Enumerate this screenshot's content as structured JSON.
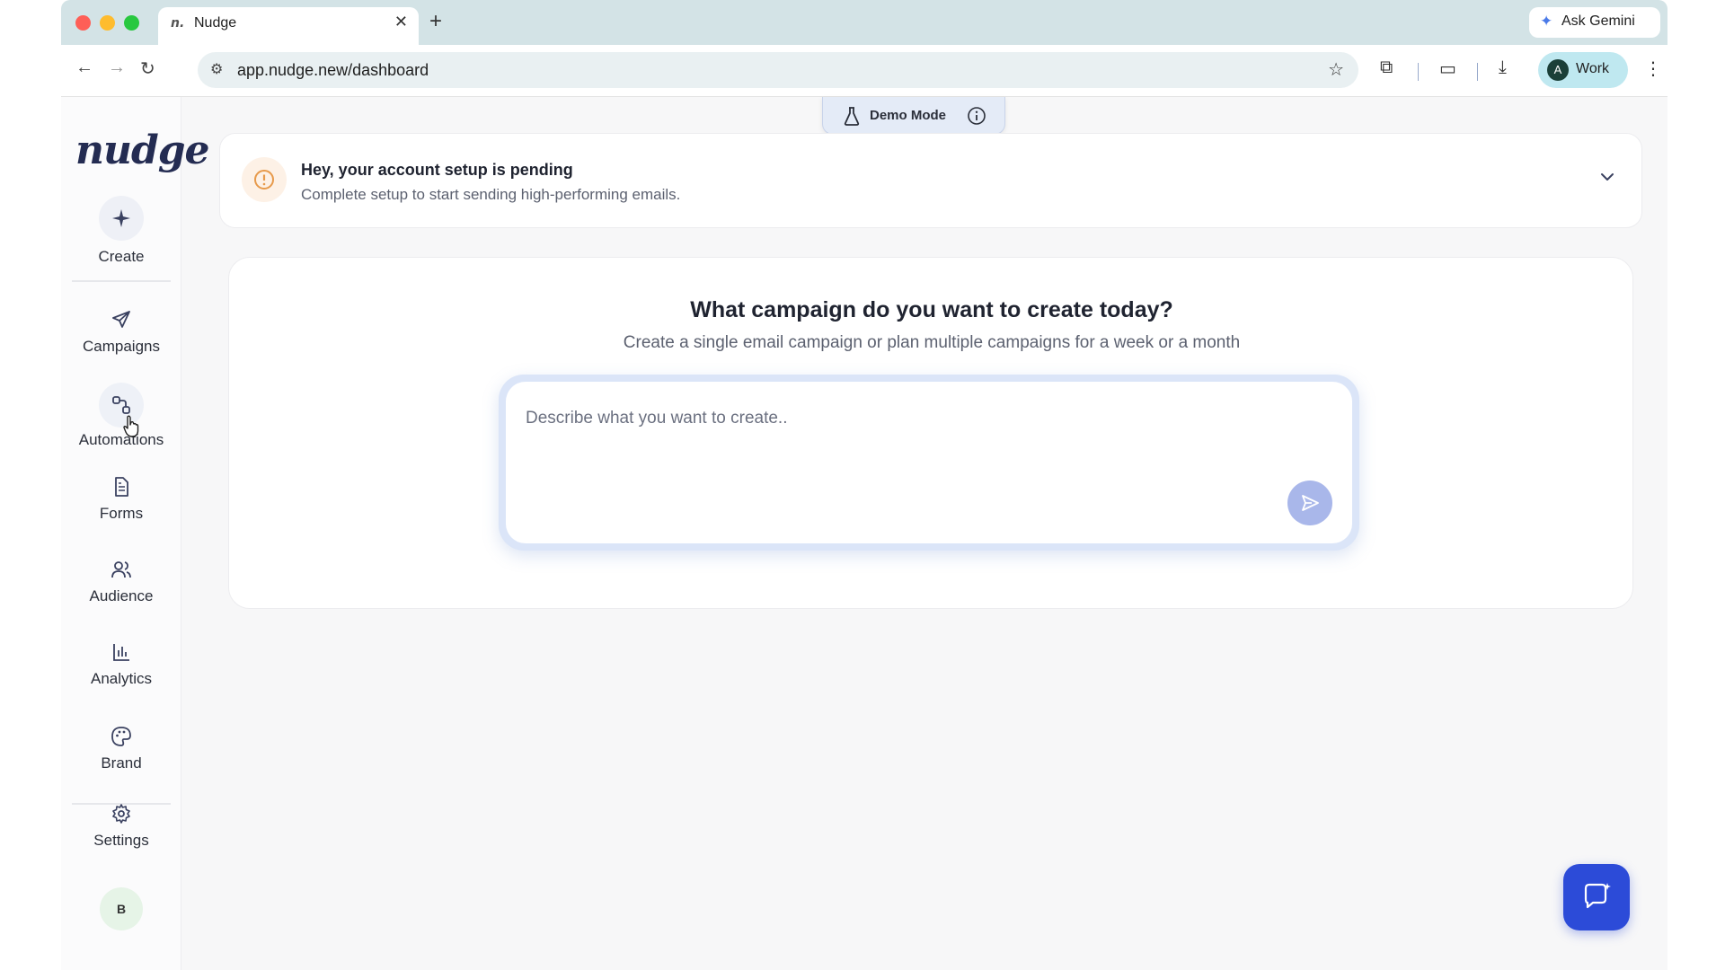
{
  "browser": {
    "tab_title": "Nudge",
    "tab_favicon": "n.",
    "ask_gemini": "Ask Gemini",
    "url": "app.nudge.new/dashboard",
    "profile_initial": "A",
    "profile_label": "Work"
  },
  "sidebar": {
    "logo": "nudge",
    "create": "Create",
    "items": [
      {
        "label": "Campaigns",
        "icon": "send-icon"
      },
      {
        "label": "Automations",
        "icon": "automation-icon"
      },
      {
        "label": "Forms",
        "icon": "document-icon"
      },
      {
        "label": "Audience",
        "icon": "users-icon"
      },
      {
        "label": "Analytics",
        "icon": "bar-chart-icon"
      },
      {
        "label": "Brand",
        "icon": "palette-icon"
      }
    ],
    "settings": "Settings",
    "avatar_initial": "B"
  },
  "demo_mode": {
    "label": "Demo Mode"
  },
  "setup_banner": {
    "title": "Hey, your account setup is pending",
    "subtitle": "Complete setup to start sending high-performing emails."
  },
  "campaign": {
    "title": "What campaign do you want to create today?",
    "subtitle": "Create a single email campaign or plan multiple campaigns for a week or a month",
    "placeholder": "Describe what you want to create.."
  },
  "colors": {
    "accent": "#2c4bd8",
    "send_button": "#a9b7ea",
    "warning": "#e79a4b"
  }
}
